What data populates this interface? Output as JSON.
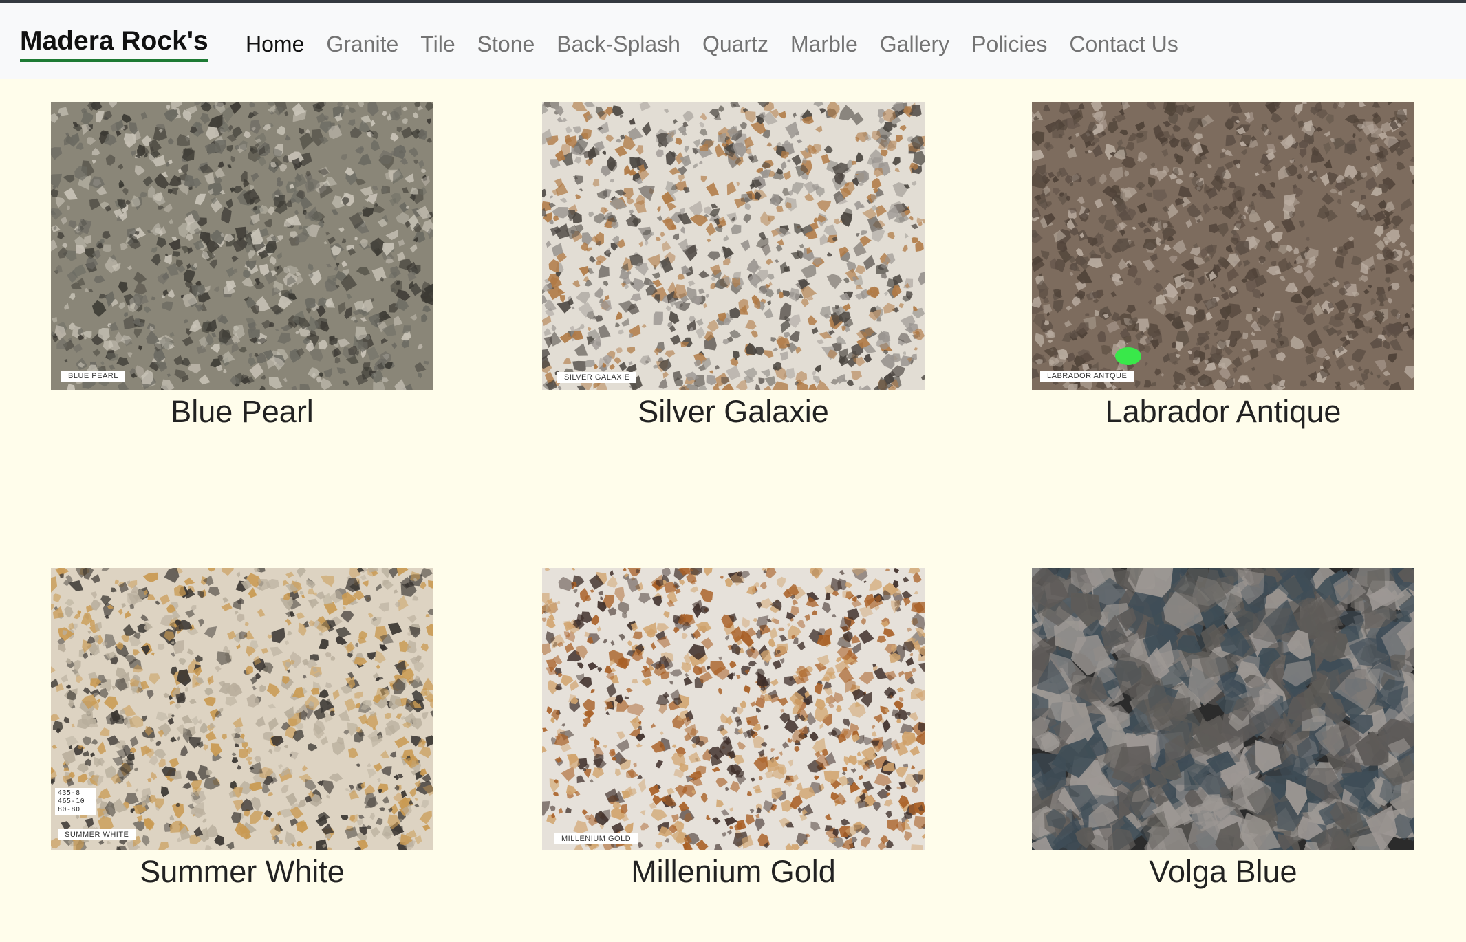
{
  "brand": {
    "name": "Madera Rock's"
  },
  "nav": {
    "items": [
      {
        "label": "Home",
        "active": true
      },
      {
        "label": "Granite"
      },
      {
        "label": "Tile"
      },
      {
        "label": "Stone"
      },
      {
        "label": "Back-Splash"
      },
      {
        "label": "Quartz"
      },
      {
        "label": "Marble"
      },
      {
        "label": "Gallery"
      },
      {
        "label": "Policies"
      },
      {
        "label": "Contact Us"
      }
    ]
  },
  "colors": {
    "page_background": "#fffdeb",
    "navbar_background": "#f8f9fa",
    "brand_underline": "#1e7b34",
    "nav_inactive": "#737373",
    "nav_active": "#111111"
  },
  "stones": [
    {
      "name": "Blue Pearl",
      "photo_tag": "BLUE PEARL",
      "palette": [
        "#8a8678",
        "#3c3a34",
        "#c9c4b8",
        "#6b6a62"
      ]
    },
    {
      "name": "Silver Galaxie",
      "photo_tag": "SILVER GALAXIE",
      "palette": [
        "#e2ddd4",
        "#4a4540",
        "#b07a45",
        "#9a9590"
      ]
    },
    {
      "name": "Labrador Antique",
      "photo_tag": "LABRADOR ANTQUE",
      "palette": [
        "#7d6c5e",
        "#4f4238",
        "#b9aca0",
        "#5c4f45"
      ]
    },
    {
      "name": "Summer White",
      "photo_tag": "SUMMER WHITE",
      "handwritten_note": "435-8 465-10 80-80",
      "palette": [
        "#ddd3c2",
        "#3a3632",
        "#c99a52",
        "#b8ae9c"
      ]
    },
    {
      "name": "Millenium Gold",
      "photo_tag": "MILLENIUM GOLD",
      "palette": [
        "#e6e1da",
        "#a85f25",
        "#d1a46e",
        "#3f2f2a"
      ]
    },
    {
      "name": "Volga Blue",
      "photo_tag": "",
      "palette": [
        "#2b2b2b",
        "#5e5b58",
        "#9d9894",
        "#3f4d57"
      ]
    }
  ]
}
